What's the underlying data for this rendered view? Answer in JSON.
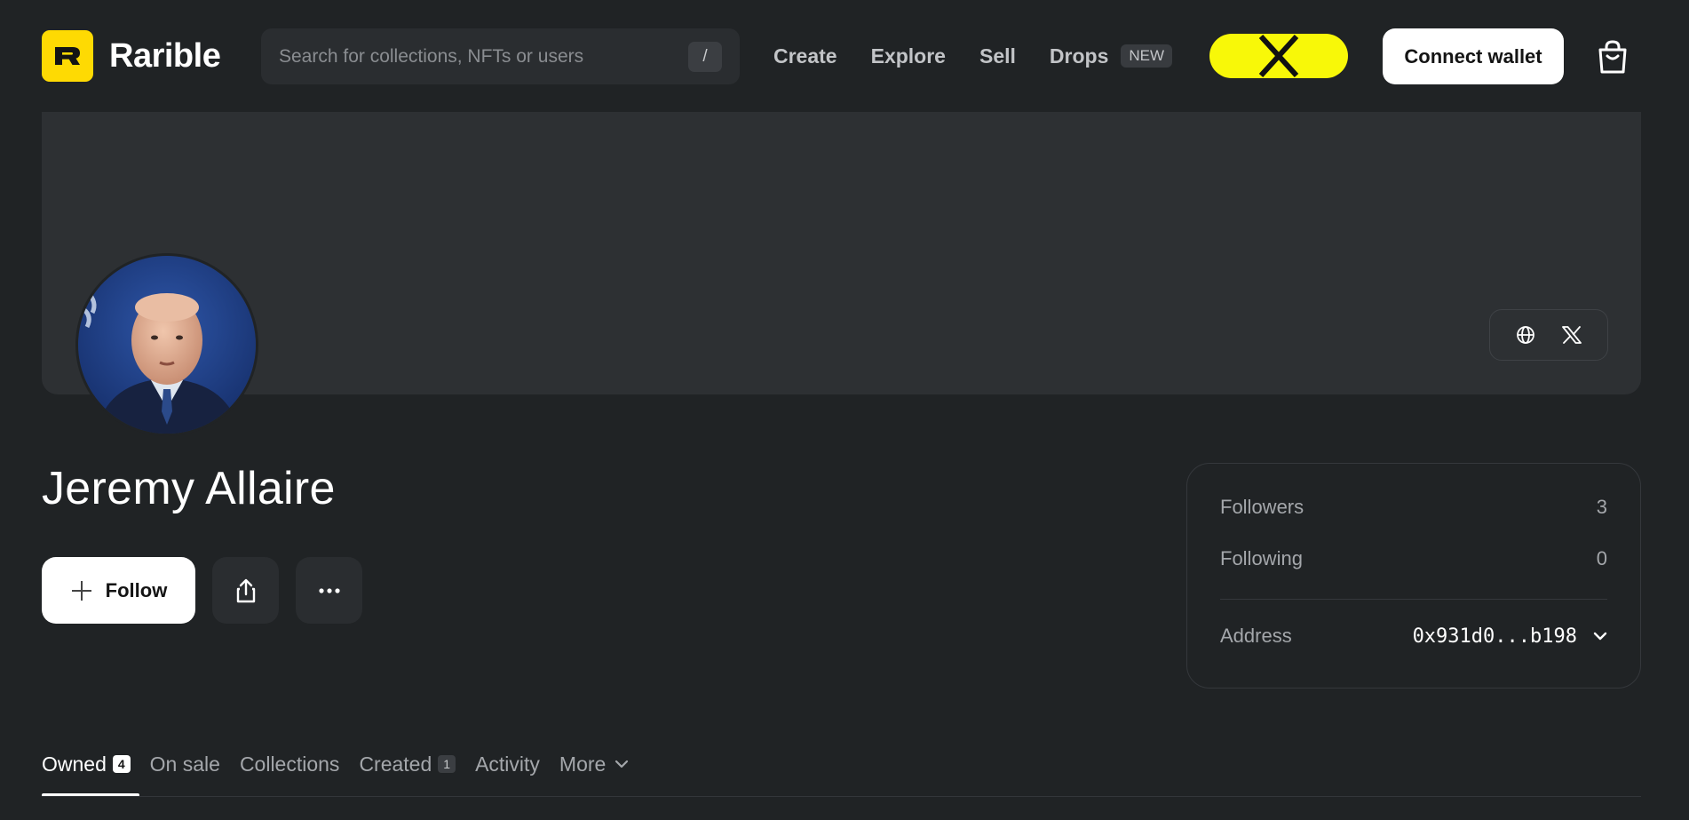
{
  "header": {
    "logo_text": "Rarible",
    "logo_mark": "R",
    "search": {
      "placeholder": "Search for collections, NFTs or users",
      "shortcut": "/"
    },
    "nav": [
      {
        "label": "Create"
      },
      {
        "label": "Explore"
      },
      {
        "label": "Sell"
      },
      {
        "label": "Drops",
        "badge": "NEW"
      }
    ],
    "connect_wallet_label": "Connect wallet",
    "icons": {
      "promo": "x-logo-icon",
      "cart": "shopping-bag-icon"
    }
  },
  "banner": {
    "social_icons": [
      "globe-icon",
      "x-logo-icon"
    ]
  },
  "profile": {
    "name": "Jeremy Allaire",
    "follow_label": "Follow",
    "stats": {
      "followers_label": "Followers",
      "followers_value": "3",
      "following_label": "Following",
      "following_value": "0",
      "address_label": "Address",
      "address_value": "0x931d0...b198"
    }
  },
  "tabs": [
    {
      "label": "Owned",
      "count": "4",
      "active": true
    },
    {
      "label": "On sale"
    },
    {
      "label": "Collections"
    },
    {
      "label": "Created",
      "count": "1"
    },
    {
      "label": "Activity"
    },
    {
      "label": "More"
    }
  ],
  "colors": {
    "background": "#202325",
    "brand_yellow": "#feda03",
    "promo_yellow": "#f8f808",
    "banner": "#2d3033"
  }
}
